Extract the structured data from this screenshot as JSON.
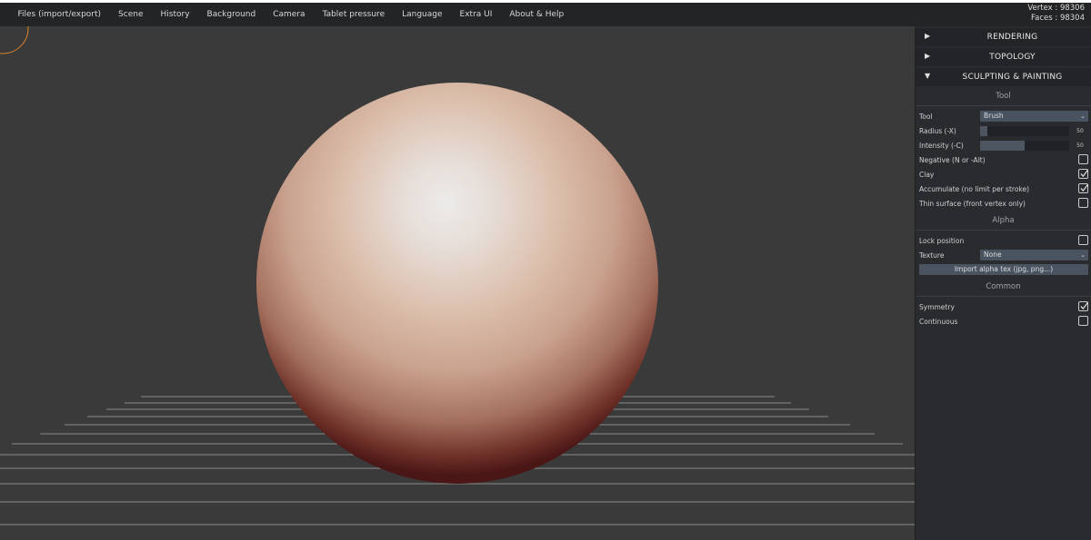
{
  "menubar": {
    "items": [
      "Files (import/export)",
      "Scene",
      "History",
      "Background",
      "Camera",
      "Tablet pressure",
      "Language",
      "Extra UI",
      "About & Help"
    ],
    "vertex_text": "Vertex : 98306",
    "faces_text": "Faces : 98304"
  },
  "panel": {
    "rendering": {
      "label": "RENDERING",
      "arrow": "▶"
    },
    "topology": {
      "label": "TOPOLOGY",
      "arrow": "▶"
    },
    "sculpting": {
      "label": "SCULPTING & PAINTING",
      "arrow": "▼"
    },
    "tool_section": "Tool",
    "tool_label": "Tool",
    "tool_value": "Brush",
    "radius_label": "Radius (-X)",
    "radius_value": "50",
    "radius_fraction": 0.08,
    "intensity_label": "Intensity (-C)",
    "intensity_value": "50",
    "intensity_fraction": 0.5,
    "negative_label": "Negative (N or -Alt)",
    "negative_checked": false,
    "clay_label": "Clay",
    "clay_checked": true,
    "accumulate_label": "Accumulate (no limit per stroke)",
    "accumulate_checked": true,
    "thin_label": "Thin surface (front vertex only)",
    "thin_checked": false,
    "alpha_section": "Alpha",
    "lock_label": "Lock position",
    "lock_checked": false,
    "texture_label": "Texture",
    "texture_value": "None",
    "import_button": "Import alpha tex (jpg, png...)",
    "common_section": "Common",
    "symmetry_label": "Symmetry",
    "symmetry_checked": true,
    "continuous_label": "Continuous",
    "continuous_checked": false
  },
  "colors": {
    "menubar_bg": "#222426",
    "viewport_bg": "#3a3a3a",
    "panel_bg": "#2a2b2e",
    "widget": "#4a5461",
    "sphere_highlight": "#ececeb",
    "sphere_shadow": "#4a1616",
    "cursor_ring": "#d9812d"
  }
}
